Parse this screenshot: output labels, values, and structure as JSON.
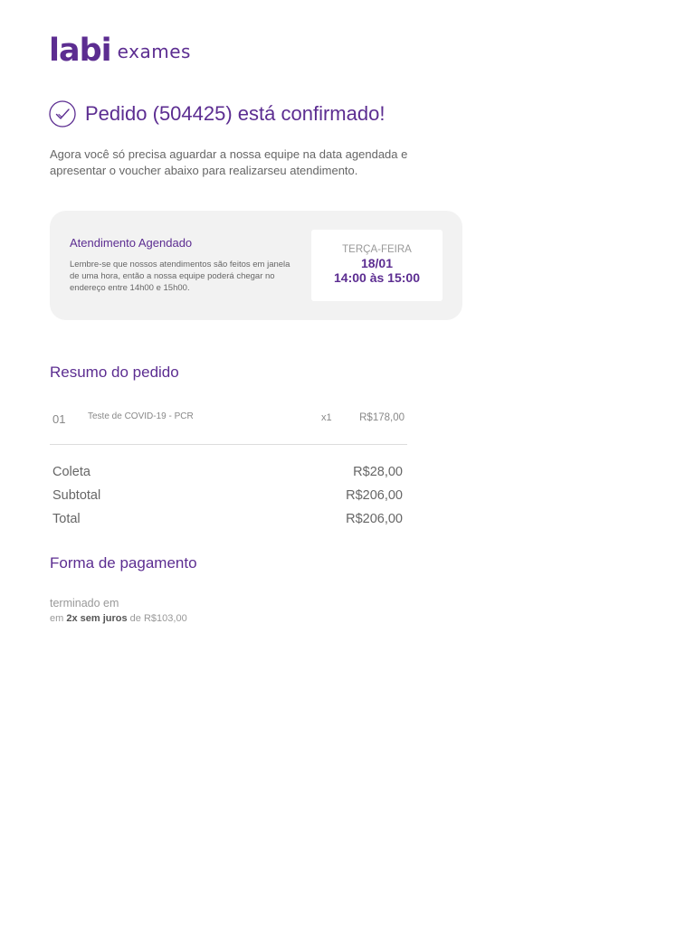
{
  "logo": {
    "mark": "labi",
    "sub": "exames"
  },
  "header": {
    "title": "Pedido (504425) está confirmado!"
  },
  "intro": {
    "text": "Agora você só precisa aguardar a nossa equipe na data agendada e apresentar o voucher abaixo para realizarseu atendimento."
  },
  "appointment": {
    "title": "Atendimento Agendado",
    "note": "Lembre-se que nossos atendimentos são feitos em janela de uma hora, então a nossa equipe poderá chegar no endereço entre 14h00 e 15h00.",
    "weekday": "TERÇA-FEIRA",
    "date": "18/01",
    "time": "14:00 às 15:00"
  },
  "summary": {
    "title": "Resumo do pedido",
    "items": [
      {
        "num": "01",
        "name": "Teste de COVID-19 - PCR",
        "qty": "x1",
        "price": "R$178,00"
      }
    ],
    "rows": [
      {
        "label": "Coleta",
        "value": "R$28,00"
      },
      {
        "label": "Subtotal",
        "value": "R$206,00"
      },
      {
        "label": "Total",
        "value": "R$206,00"
      }
    ]
  },
  "payment": {
    "title": "Forma de pagamento",
    "label": "terminado em",
    "prefix": "em",
    "installments": "2x sem juros",
    "mid": "de",
    "amount": "R$103,00"
  },
  "colors": {
    "brand": "#5c2d91",
    "card": "#f2f2f2",
    "text": "#666666"
  },
  "icons": {
    "confirm": "check-circle-icon"
  }
}
